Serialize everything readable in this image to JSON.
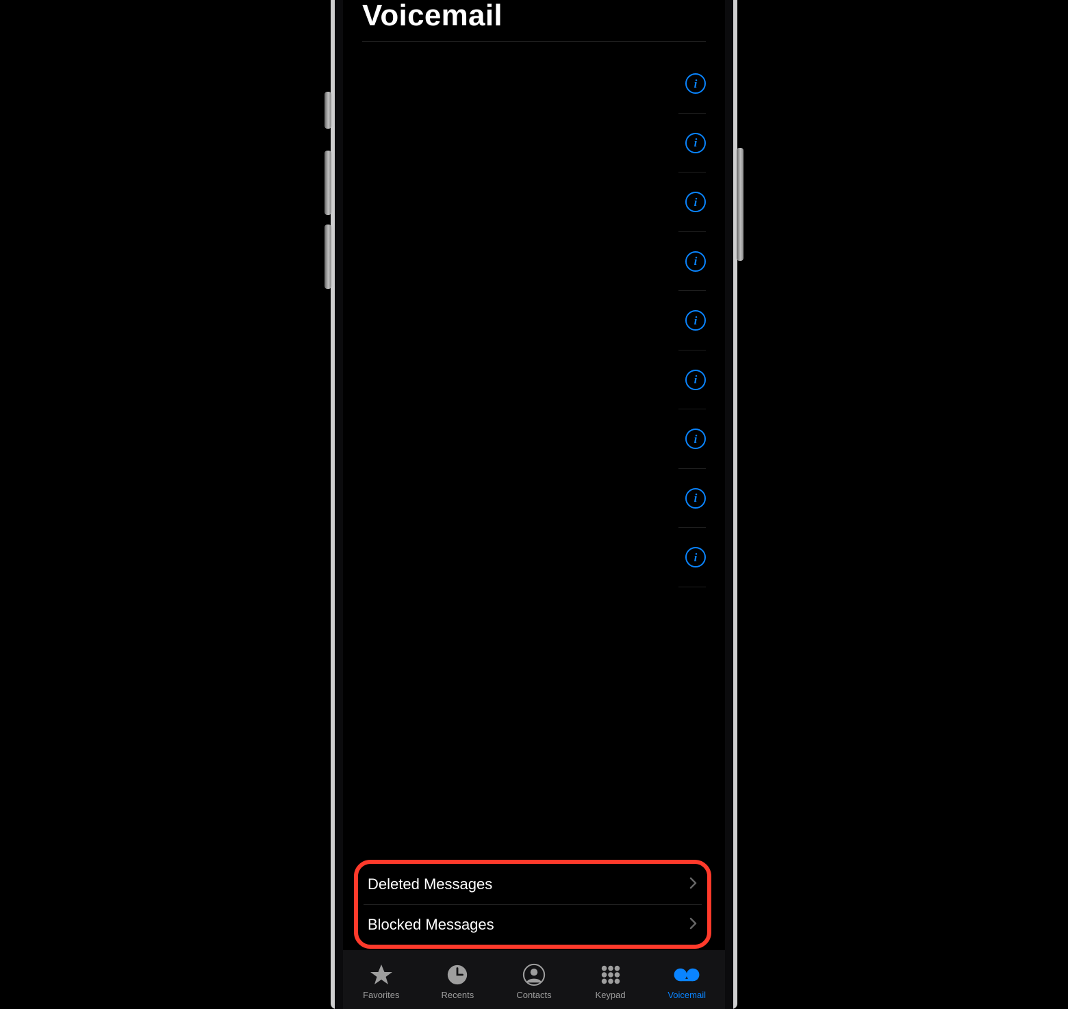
{
  "header": {
    "title": "Voicemail"
  },
  "rows": {
    "count": 9
  },
  "messages": {
    "deleted": "Deleted Messages",
    "blocked": "Blocked Messages"
  },
  "tabs": {
    "favorites": "Favorites",
    "recents": "Recents",
    "contacts": "Contacts",
    "keypad": "Keypad",
    "voicemail": "Voicemail",
    "active": "voicemail"
  },
  "colors": {
    "accent": "#0a84ff",
    "highlight": "#ff3a2b",
    "inactive": "#9e9e9e"
  }
}
